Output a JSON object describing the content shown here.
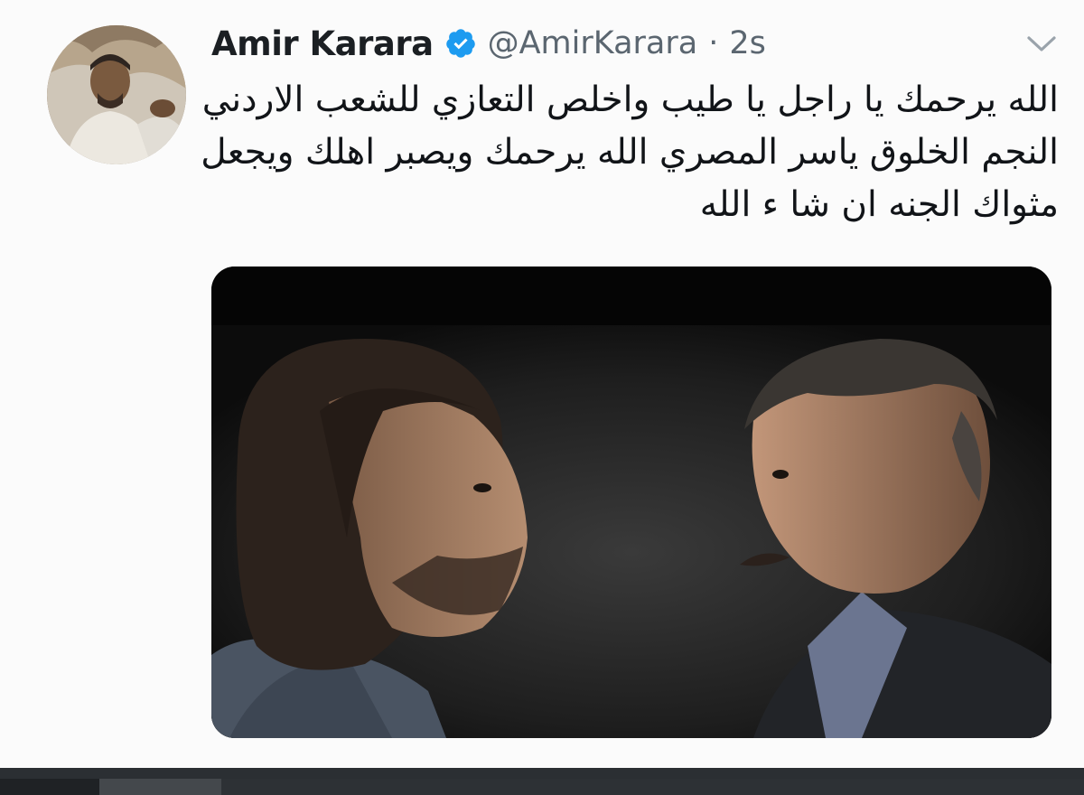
{
  "tweet": {
    "display_name": "Amir Karara",
    "verified_icon": "verified-badge-icon",
    "handle": "@AmirKarara",
    "separator": "·",
    "timestamp": "2s",
    "menu_icon": "chevron-down-icon",
    "text_lines": [
      "الله يرحمك يا راجل يا طيب واخلص التعازي للشعب الاردني",
      "النجم الخلوق ياسر المصري الله يرحمك ويصبر اهلك ويجعل",
      "مثواك الجنه ان شا ء الله"
    ]
  },
  "colors": {
    "verified": "#1d9bf0",
    "name": "#1b1f23",
    "secondary": "#5b6670",
    "text": "#111418"
  }
}
